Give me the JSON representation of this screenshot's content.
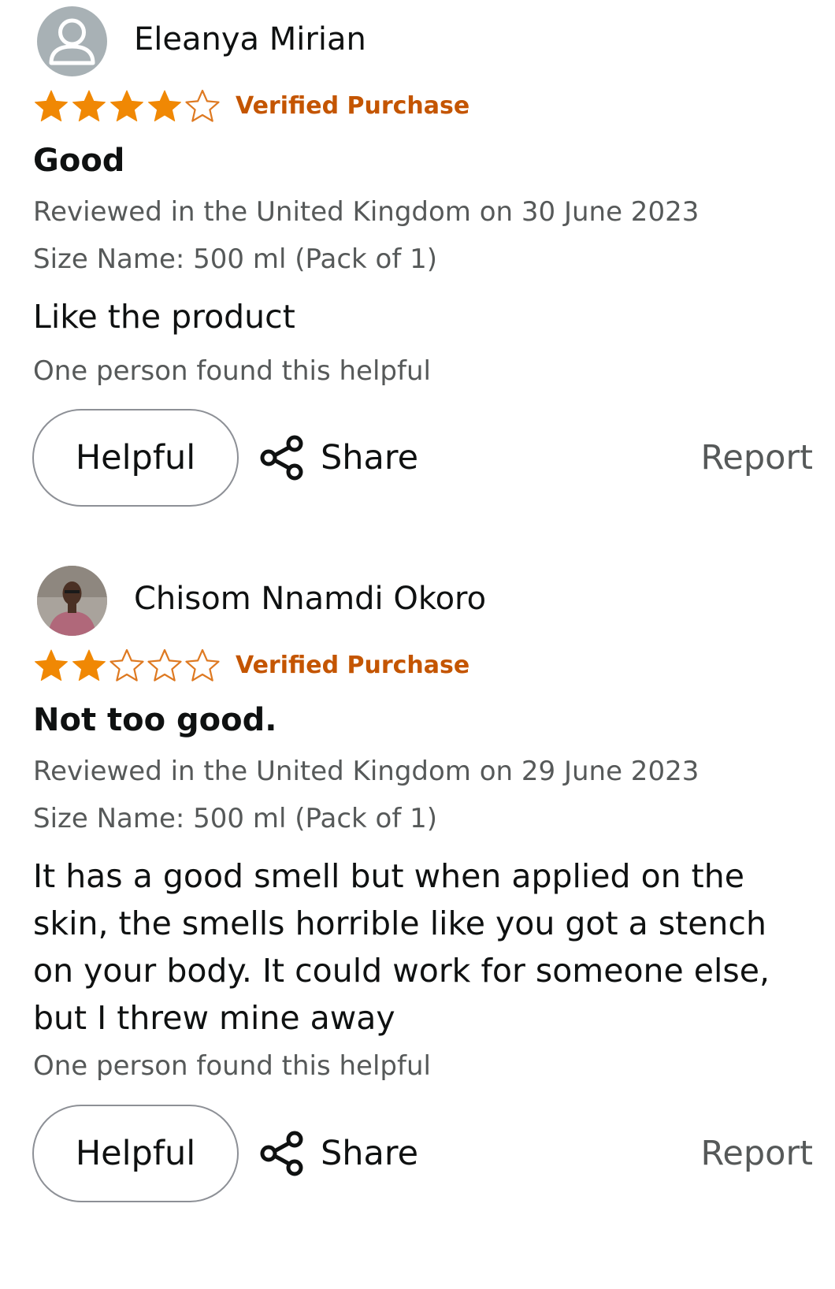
{
  "reviews": [
    {
      "reviewer": "Eleanya Mirian",
      "avatar": "generic-user-icon",
      "rating": 4,
      "rating_max": 5,
      "verified_label": "Verified Purchase",
      "title": "Good",
      "date_text": "Reviewed in the United Kingdom on 30 June 2023",
      "size_text": "Size Name: 500 ml (Pack of 1)",
      "body": "Like the product",
      "helpful_text": "One person found this helpful",
      "helpful_label": "Helpful",
      "share_label": "Share",
      "report_label": "Report"
    },
    {
      "reviewer": "Chisom Nnamdi Okoro",
      "avatar": "profile-photo",
      "rating": 2,
      "rating_max": 5,
      "verified_label": "Verified Purchase",
      "title": "Not too good.",
      "date_text": "Reviewed in the United Kingdom on 29 June 2023",
      "size_text": "Size Name: 500 ml (Pack of 1)",
      "body": "It has a good smell but when applied on the skin, the smells horrible like you got a stench on your body. It could work for someone else, but I threw mine away",
      "helpful_text": "One person found this helpful",
      "helpful_label": "Helpful",
      "share_label": "Share",
      "report_label": "Report"
    }
  ],
  "colors": {
    "star_fill": "#f08804",
    "star_outline": "#de7921",
    "verified": "#c45500",
    "text_primary": "#0f1111",
    "text_secondary": "#565959",
    "button_border": "#8d9096"
  }
}
